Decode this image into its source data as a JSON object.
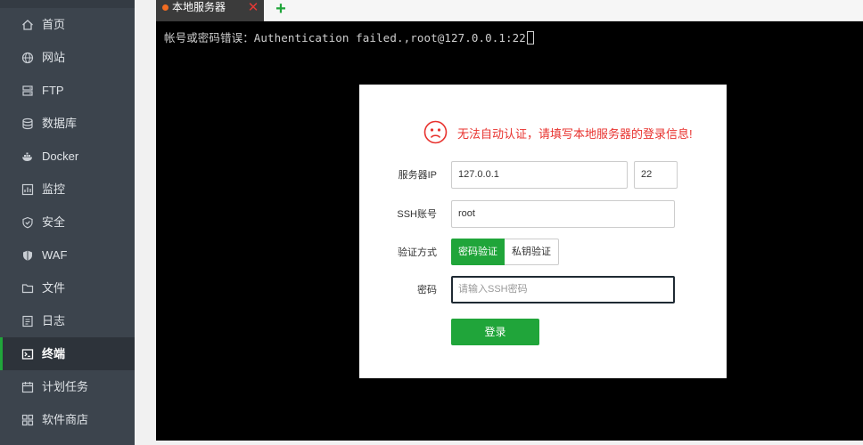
{
  "sidebar": {
    "items": [
      {
        "label": "首页",
        "icon": "home-icon"
      },
      {
        "label": "网站",
        "icon": "globe-icon"
      },
      {
        "label": "FTP",
        "icon": "ftp-icon"
      },
      {
        "label": "数据库",
        "icon": "database-icon"
      },
      {
        "label": "Docker",
        "icon": "docker-icon"
      },
      {
        "label": "监控",
        "icon": "monitor-icon"
      },
      {
        "label": "安全",
        "icon": "shield-icon"
      },
      {
        "label": "WAF",
        "icon": "waf-shield-icon"
      },
      {
        "label": "文件",
        "icon": "folder-icon"
      },
      {
        "label": "日志",
        "icon": "log-icon"
      },
      {
        "label": "终端",
        "icon": "terminal-icon",
        "active": true
      },
      {
        "label": "计划任务",
        "icon": "calendar-icon"
      },
      {
        "label": "软件商店",
        "icon": "apps-icon"
      }
    ]
  },
  "tabs": {
    "items": [
      {
        "label": "本地服务器",
        "close": "✕"
      }
    ],
    "add_label": "+"
  },
  "terminal": {
    "line": "帐号或密码错误：Authentication failed.,root@127.0.0.1:22"
  },
  "dialog": {
    "error_message": "无法自动认证，请填写本地服务器的登录信息!",
    "ip_label": "服务器IP",
    "ip_value": "127.0.0.1",
    "port_value": "22",
    "account_label": "SSH账号",
    "account_value": "root",
    "auth_label": "验证方式",
    "auth_options": [
      "密码验证",
      "私钥验证"
    ],
    "selected_auth": "密码验证",
    "password_label": "密码",
    "password_placeholder": "请输入SSH密码",
    "login_label": "登录"
  },
  "colors": {
    "sidebar_bg": "#3c444d",
    "sidebar_active_bg": "#2d333a",
    "accent_green": "#20a53a",
    "error_red": "#e8322e",
    "tab_dot": "#f36c21",
    "terminal_bg": "#000000"
  }
}
